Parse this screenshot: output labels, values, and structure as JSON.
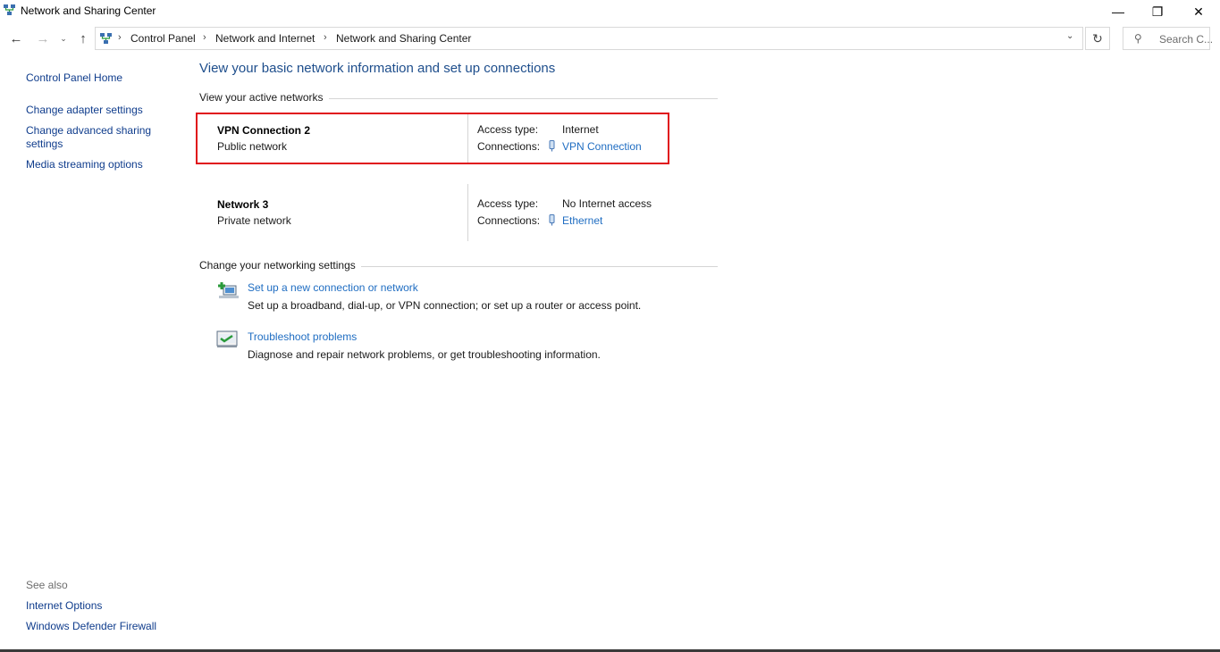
{
  "window": {
    "title": "Network and Sharing Center",
    "min_glyph": "—",
    "max_glyph": "❐",
    "close_glyph": "✕"
  },
  "nav": {
    "back_glyph": "←",
    "forward_glyph": "→",
    "recent_glyph": "⌄",
    "up_glyph": "↑",
    "breadcrumbs": [
      "Control Panel",
      "Network and Internet",
      "Network and Sharing Center"
    ],
    "separator": "›",
    "dropdown_glyph": "⌄",
    "refresh_glyph": "↻",
    "search_placeholder": "Search C...",
    "search_icon": "search-icon"
  },
  "sidebar": {
    "home": "Control Panel Home",
    "items": [
      "Change adapter settings",
      "Change advanced sharing settings",
      "Media streaming options"
    ],
    "see_also_label": "See also",
    "see_also": [
      "Internet Options",
      "Windows Defender Firewall"
    ]
  },
  "main": {
    "heading": "View your basic network information and set up connections",
    "active_label": "View your active networks",
    "networks": [
      {
        "name": "VPN Connection 2",
        "category": "Public network",
        "access_key": "Access type:",
        "access_value": "Internet",
        "conn_key": "Connections:",
        "conn_value": "VPN Connection"
      },
      {
        "name": "Network 3",
        "category": "Private network",
        "access_key": "Access type:",
        "access_value": "No Internet access",
        "conn_key": "Connections:",
        "conn_value": "Ethernet"
      }
    ],
    "settings_label": "Change your networking settings",
    "tasks": [
      {
        "link": "Set up a new connection or network",
        "desc": "Set up a broadband, dial-up, or VPN connection; or set up a router or access point.",
        "icon": "new-connection-icon"
      },
      {
        "link": "Troubleshoot problems",
        "desc": "Diagnose and repair network problems, or get troubleshooting information.",
        "icon": "troubleshoot-icon"
      }
    ]
  },
  "colors": {
    "link": "#1f6dc2",
    "nav_link": "#0f3c8c",
    "heading": "#1e4e8c",
    "highlight": "#e0101a"
  }
}
